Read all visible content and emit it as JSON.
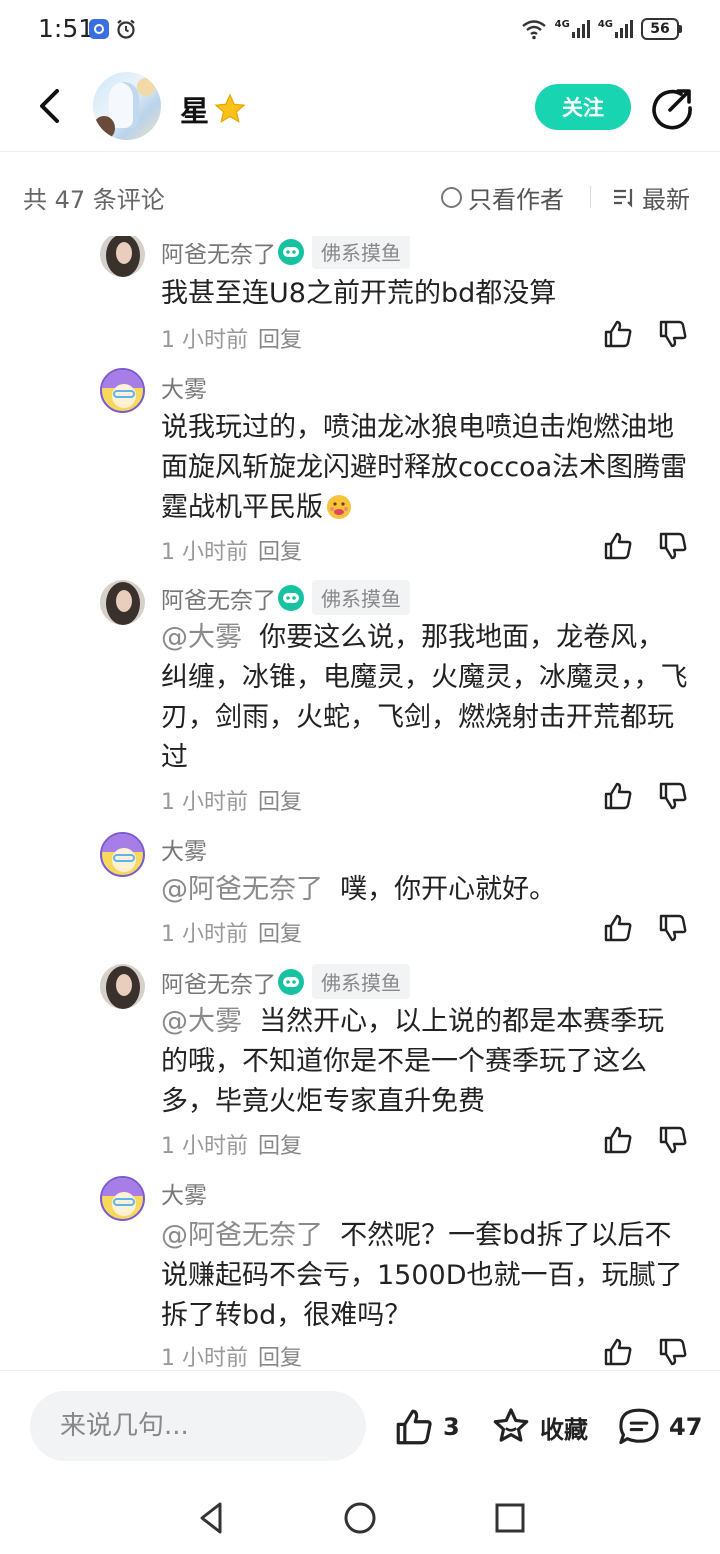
{
  "status_bar": {
    "time": "1:51",
    "battery": "56",
    "network_label_1": "4G",
    "network_label_2": "4G"
  },
  "header": {
    "user_name": "星",
    "follow_label": "关注"
  },
  "comments_bar": {
    "count_text": "共 47 条评论",
    "only_author_label": "只看作者",
    "sort_label": "最新"
  },
  "replies": [
    {
      "author": "阿爸无奈了",
      "badge": "佛系摸鱼",
      "text": "我甚至连U8之前开荒的bd都没算",
      "time": "1 小时前",
      "reply_label": "回复"
    },
    {
      "author": "大雾",
      "badge": "",
      "text": "说我玩过的，喷油龙冰狼电喷迫击炮燃油地面旋风斩旋龙闪避时释放coccoa法术图腾雷霆战机平民版",
      "time": "1 小时前",
      "reply_label": "回复"
    },
    {
      "author": "阿爸无奈了",
      "badge": "佛系摸鱼",
      "mention": "@大雾",
      "text": "你要这么说，那我地面，龙卷风，纠缠，冰锥，电魔灵，火魔灵，冰魔灵，，飞刃，剑雨，火蛇，飞剑，燃烧射击开荒都玩过",
      "time": "1 小时前",
      "reply_label": "回复"
    },
    {
      "author": "大雾",
      "badge": "",
      "mention": "@阿爸无奈了",
      "text": "噗，你开心就好。",
      "time": "1 小时前",
      "reply_label": "回复"
    },
    {
      "author": "阿爸无奈了",
      "badge": "佛系摸鱼",
      "mention": "@大雾",
      "text": "当然开心，以上说的都是本赛季玩的哦，不知道你是不是一个赛季玩了这么多，毕竟火炬专家直升免费",
      "time": "1 小时前",
      "reply_label": "回复"
    },
    {
      "author": "大雾",
      "badge": "",
      "mention": "@阿爸无奈了",
      "text": "不然呢？一套bd拆了以后不说赚起码不会亏，1500D也就一百，玩腻了拆了转bd，很难吗？",
      "time": "1 小时前",
      "reply_label": "回复"
    }
  ],
  "bottom_bar": {
    "input_placeholder": "来说几句...",
    "like_count": "3",
    "collect_label": "收藏",
    "comment_count": "47"
  },
  "colors": {
    "accent": "#18d4b0",
    "badge_green": "#16c2a0",
    "text_primary": "#222222",
    "text_secondary": "#999999"
  }
}
